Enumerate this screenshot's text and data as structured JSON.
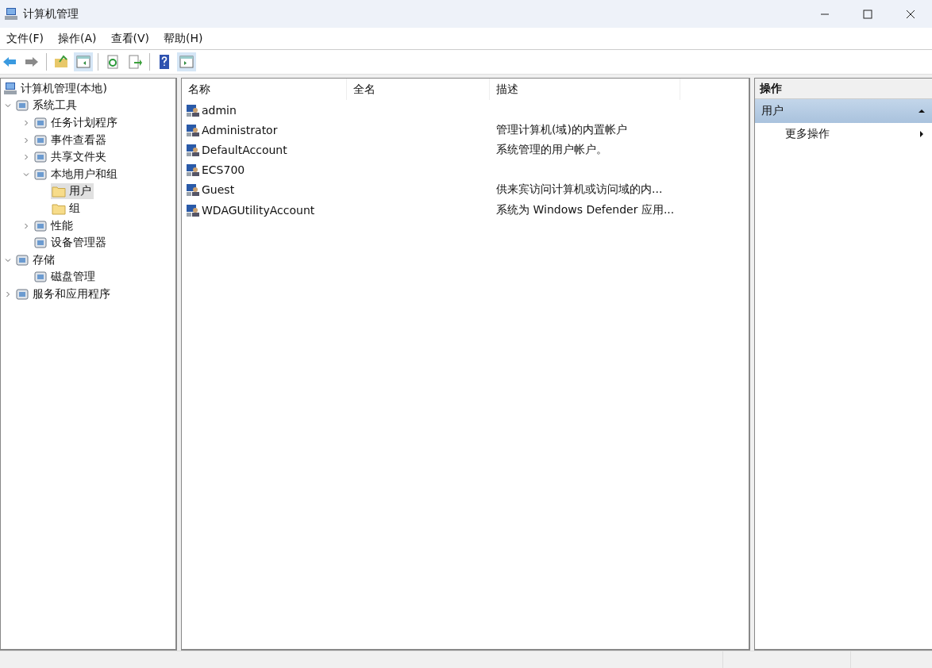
{
  "window": {
    "title": "计算机管理"
  },
  "menu": [
    "文件(F)",
    "操作(A)",
    "查看(V)",
    "帮助(H)"
  ],
  "toolbar": [
    {
      "pressed": false
    },
    {
      "pressed": false
    },
    {
      "pressed": false
    },
    {
      "pressed": true
    },
    {
      "pressed": false
    },
    {
      "pressed": false
    },
    {
      "pressed": false
    },
    {
      "pressed": true
    }
  ],
  "tree": [
    {
      "label": "计算机管理(本地)",
      "selected": false,
      "children": [
        {
          "label": "系统工具",
          "selected": false,
          "expanded": true,
          "children": [
            {
              "label": "任务计划程序",
              "selected": false,
              "expanded": false
            },
            {
              "label": "事件查看器",
              "selected": false,
              "expanded": false
            },
            {
              "label": "共享文件夹",
              "selected": false,
              "expanded": false
            },
            {
              "label": "本地用户和组",
              "selected": false,
              "expanded": true,
              "children": [
                {
                  "label": "用户",
                  "selected": true
                },
                {
                  "label": "组",
                  "selected": false
                }
              ]
            },
            {
              "label": "性能",
              "selected": false,
              "expanded": false
            },
            {
              "label": "设备管理器",
              "selected": false
            }
          ]
        },
        {
          "label": "存储",
          "selected": false,
          "expanded": true,
          "children": [
            {
              "label": "磁盘管理",
              "selected": false
            }
          ]
        },
        {
          "label": "服务和应用程序",
          "selected": false,
          "expanded": false
        }
      ]
    }
  ],
  "table": {
    "columns": [
      "名称",
      "全名",
      "描述"
    ],
    "rows": [
      {
        "name": "admin",
        "selected": false
      },
      {
        "name": "Administrator",
        "description": "管理计算机(域)的内置帐户",
        "selected": false
      },
      {
        "name": "DefaultAccount",
        "description": "系统管理的用户帐户。",
        "selected": false
      },
      {
        "name": "ECS700",
        "selected": false
      },
      {
        "name": "Guest",
        "description": "供来宾访问计算机或访问域的内...",
        "selected": false
      },
      {
        "name": "WDAGUtilityAccount",
        "description": "系统为 Windows Defender 应用...",
        "selected": false
      }
    ]
  },
  "actions": {
    "title": "操作",
    "sections": [
      {
        "label": "用户",
        "expanded": true,
        "items": [
          {
            "label": "更多操作"
          }
        ]
      }
    ]
  }
}
